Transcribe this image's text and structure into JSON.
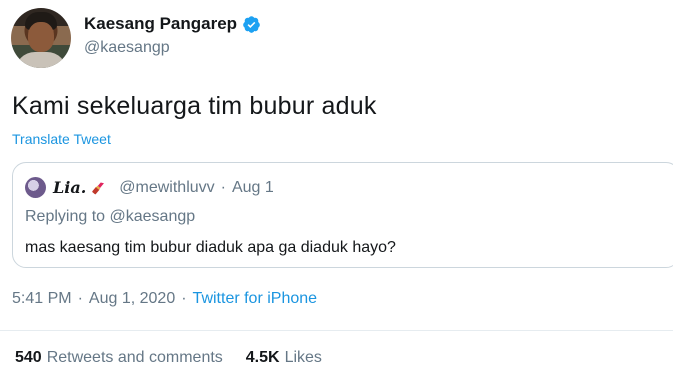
{
  "author": {
    "display_name": "Kaesang Pangarep",
    "handle": "@kaesangp",
    "verified_icon": "verified-badge-icon",
    "verified_color": "#1da1f2"
  },
  "tweet": {
    "text": "Kami sekeluarga tim bubur aduk",
    "translate_label": "Translate Tweet"
  },
  "quoted_tweet": {
    "display_name": "Lia.",
    "name_emoji_icon": "lipstick-icon",
    "handle": "@mewithluvv",
    "separator": "·",
    "date": "Aug 1",
    "replying_prefix": "Replying to",
    "replying_to": "@kaesangp",
    "text": "mas kaesang tim bubur diaduk apa ga diaduk hayo?"
  },
  "meta": {
    "time": "5:41 PM",
    "separator": "·",
    "date": "Aug 1, 2020",
    "separator2": "·",
    "source": "Twitter for iPhone"
  },
  "stats": {
    "retweets_count": "540",
    "retweets_label": "Retweets and comments",
    "likes_count": "4.5K",
    "likes_label": "Likes"
  },
  "colors": {
    "link": "#1b95e0",
    "secondary_text": "#657786",
    "primary_text": "#14171a",
    "border": "#ccd6dd"
  }
}
